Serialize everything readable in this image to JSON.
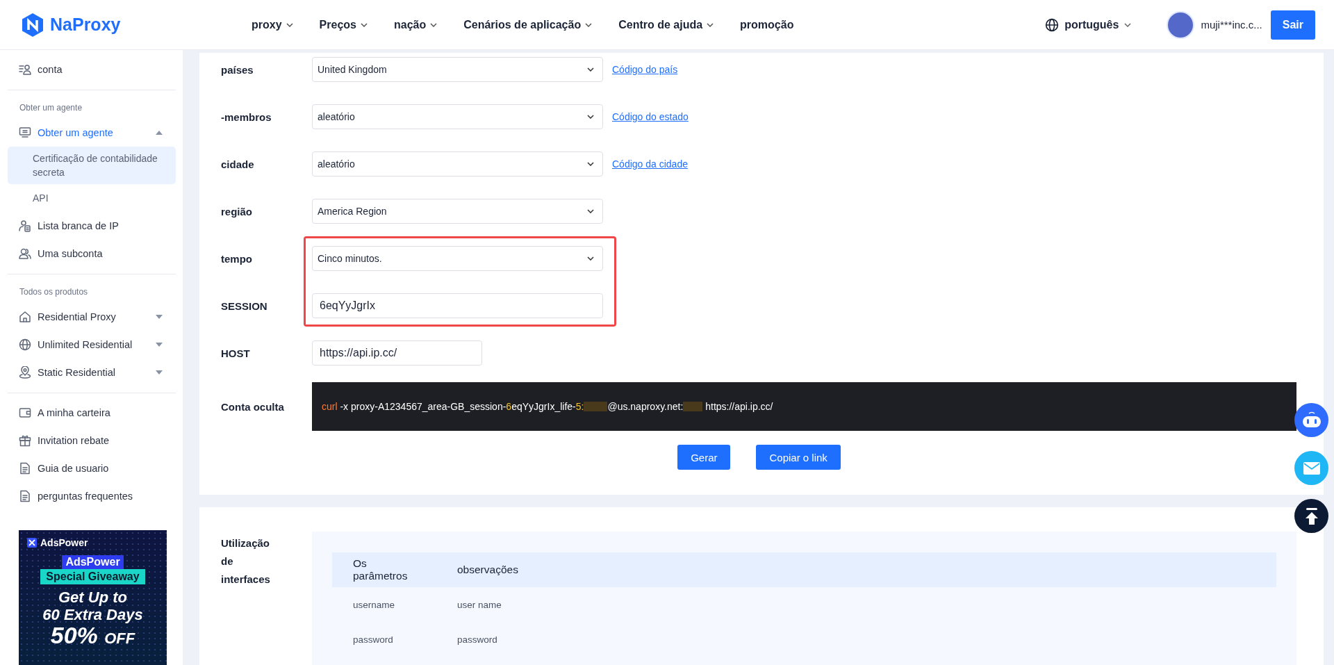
{
  "header": {
    "brand": "NaProxy",
    "nav": [
      {
        "label": "proxy",
        "dropdown": true
      },
      {
        "label": "Preços",
        "dropdown": true
      },
      {
        "label": "nação",
        "dropdown": true
      },
      {
        "label": "Cenários de aplicação",
        "dropdown": true
      },
      {
        "label": "Centro de ajuda",
        "dropdown": true
      },
      {
        "label": "promoção",
        "dropdown": false
      }
    ],
    "language": "português",
    "username": "muji***inc.c...",
    "logout": "Sair"
  },
  "sidebar": {
    "groups": [
      {
        "items": [
          {
            "label": "conta",
            "selected": false
          }
        ]
      },
      {
        "heading": "Obter um agente",
        "items": [
          {
            "label": "Obter um agente",
            "selected": true,
            "expanded": true,
            "children": [
              {
                "label": "Certificação de contabilidade secreta",
                "selected": true
              },
              {
                "label": "API",
                "selected": false
              }
            ]
          },
          {
            "label": "Lista branca de IP",
            "selected": false
          },
          {
            "label": "Uma subconta",
            "selected": false
          }
        ]
      },
      {
        "heading": "Todos os produtos",
        "items": [
          {
            "label": "Residential Proxy",
            "selected": false,
            "expanded": false
          },
          {
            "label": "Unlimited Residential",
            "selected": false,
            "expanded": false
          },
          {
            "label": "Static Residential",
            "selected": false,
            "expanded": false
          }
        ]
      },
      {
        "items": [
          {
            "label": "A minha carteira",
            "selected": false
          },
          {
            "label": "Invitation rebate",
            "selected": false
          },
          {
            "label": "Guia de usuario",
            "selected": false
          },
          {
            "label": "perguntas frequentes",
            "selected": false
          }
        ]
      }
    ]
  },
  "ad": {
    "brand": "AdsPower",
    "tag": "AdsPower",
    "ribbon": "Special Giveaway",
    "headline": [
      "Get Up to",
      "60 Extra Days"
    ],
    "discount": "50%",
    "discount_suffix": "OFF"
  },
  "form": {
    "rows": [
      {
        "kind": "select",
        "label": "países",
        "value": "United Kingdom",
        "link": "Código do país",
        "highlighted": false
      },
      {
        "kind": "select",
        "label": "-membros",
        "value": "aleatório",
        "link": "Código do estado",
        "highlighted": false
      },
      {
        "kind": "select",
        "label": "cidade",
        "value": "aleatório",
        "link": "Código da cidade",
        "highlighted": false
      },
      {
        "kind": "select",
        "label": "região",
        "value": "America Region",
        "highlighted": false
      },
      {
        "kind": "select",
        "label": "tempo",
        "value": "Cinco minutos.",
        "highlighted": true
      },
      {
        "kind": "input",
        "label": "SESSION",
        "value": "6eqYyJgrIx",
        "highlighted": true
      },
      {
        "kind": "short-input",
        "label": "HOST",
        "value": "https://api.ip.cc/",
        "highlighted": false
      },
      {
        "kind": "command",
        "label": "Conta oculta",
        "highlighted": false,
        "segments": [
          {
            "kind": "keyword",
            "text": "curl"
          },
          {
            "kind": "plain",
            "text": " -x proxy-A1234567_area-GB_session-"
          },
          {
            "kind": "number",
            "text": "6"
          },
          {
            "kind": "plain",
            "text": "eqYyJgrIx_life-"
          },
          {
            "kind": "number",
            "text": "5:"
          },
          {
            "kind": "redacted"
          },
          {
            "kind": "plain",
            "text": "@us.naproxy.net:"
          },
          {
            "kind": "redacted"
          },
          {
            "kind": "plain",
            "text": " https://api.ip.cc/"
          }
        ]
      }
    ],
    "buttons": [
      "Gerar",
      "Copiar o link"
    ]
  },
  "usage": {
    "title": "Utilização de interfaces",
    "columns": [
      "Os parâmetros",
      "observações"
    ],
    "rows": [
      [
        "username",
        "user name"
      ],
      [
        "password",
        "password"
      ]
    ]
  }
}
